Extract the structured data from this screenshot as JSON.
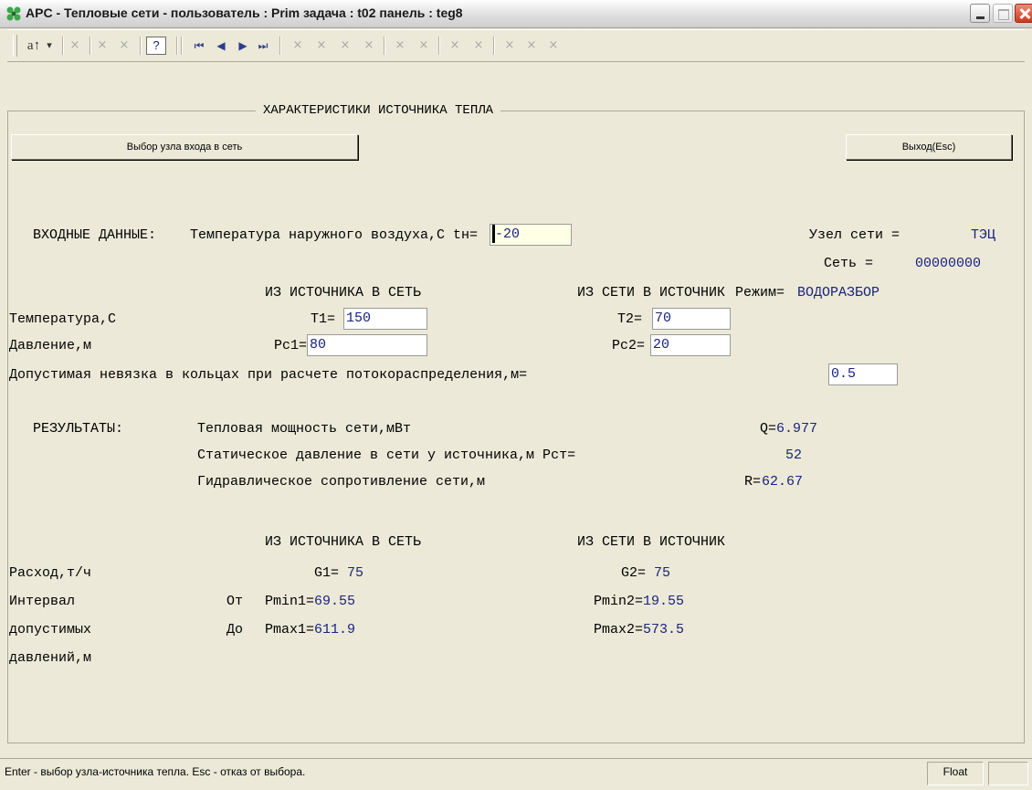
{
  "window": {
    "title": "APC - Тепловые сети -   пользователь : Prim  задача : t02  панель : teg8"
  },
  "toolbar": {
    "sort_label": "a↑",
    "sort_arrow": "▾",
    "disabled_x": "×",
    "help_label": "?",
    "nav_first": "⏮",
    "nav_prev": "◀",
    "nav_next": "▶",
    "nav_last": "⏭"
  },
  "panel": {
    "title": "ХАРАКТЕРИСТИКИ ИСТОЧНИКА ТЕПЛА",
    "select_node_button": "Выбор узла входа в сеть",
    "exit_button": "Выход(Esc)"
  },
  "input": {
    "section_label": "ВХОДНЫЕ ДАННЫЕ:",
    "outdoor_temp_label": "Температура наружного воздуха,С tн=",
    "outdoor_temp_value": "-20",
    "node_label": "Узел сети =",
    "node_value": "ТЭЦ",
    "network_label": "Сеть =",
    "network_value": "00000000",
    "col_source_to_net": "ИЗ ИСТОЧНИКА В СЕТЬ",
    "col_net_to_source": "ИЗ СЕТИ В ИСТОЧНИК",
    "mode_label": "Режим=",
    "mode_value": "ВОДОРАЗБОР",
    "temp_row_label": "Температура,С",
    "t1_label": "T1=",
    "t1_value": "150",
    "t2_label": "T2=",
    "t2_value": "70",
    "pressure_row_label": "Давление,м",
    "pc1_label": "Pc1=",
    "pc1_value": "80",
    "pc2_label": "Pc2=",
    "pc2_value": "20",
    "tolerance_label": "Допустимая невязка в кольцах при расчете потокораспределения,м=",
    "tolerance_value": "0.5"
  },
  "results": {
    "section_label": "РЕЗУЛЬТАТЫ:",
    "power_label": "Тепловая мощность сети,мВт",
    "power_key": "Q=",
    "power_value": "6.977",
    "static_label": "Статическое давление в сети у источника,м Pст=",
    "static_value": "52",
    "hydraulic_label": "Гидравлическое сопротивление сети,м",
    "hydraulic_key": "R=",
    "hydraulic_value": "62.67",
    "col_source_to_net": "ИЗ ИСТОЧНИКА В СЕТЬ",
    "col_net_to_source": "ИЗ СЕТИ В ИСТОЧНИК",
    "flow_label": "Расход,т/ч",
    "g1_label": "G1=",
    "g1_value": "75",
    "g2_label": "G2=",
    "g2_value": "75",
    "interval_label_1": "Интервал",
    "interval_label_2": "допустимых",
    "interval_label_3": "давлений,м",
    "from_label": "От",
    "to_label": "До",
    "pmin1_label": "Pmin1=",
    "pmin1_value": "69.55",
    "pmin2_label": "Pmin2=",
    "pmin2_value": "19.55",
    "pmax1_label": "Pmax1=",
    "pmax1_value": "611.9",
    "pmax2_label": "Pmax2=",
    "pmax2_value": "573.5"
  },
  "status": {
    "hint": "Enter - выбор узла-источника тепла.  Esc - отказ от выбора.",
    "mode": "Float"
  }
}
